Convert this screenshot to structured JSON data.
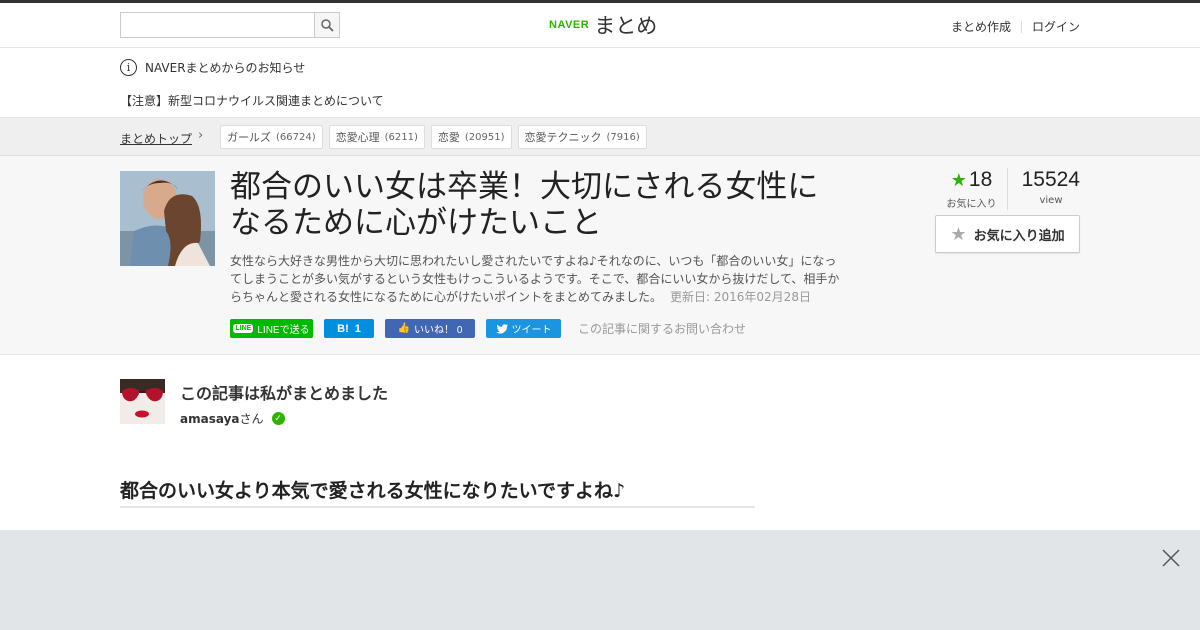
{
  "header": {
    "search_placeholder": "",
    "logo_brand": "NAVER",
    "logo_title": "まとめ",
    "create_link": "まとめ作成",
    "login_link": "ログイン"
  },
  "notice": {
    "heading": "NAVERまとめからのお知らせ",
    "item": "【注意】新型コロナウイルス関連まとめについて"
  },
  "breadcrumb": {
    "top": "まとめトップ",
    "tags": [
      {
        "label": "ガールズ",
        "count": "(66724)"
      },
      {
        "label": "恋愛心理",
        "count": "(6211)"
      },
      {
        "label": "恋愛",
        "count": "(20951)"
      },
      {
        "label": "恋愛テクニック",
        "count": "(7916)"
      }
    ]
  },
  "article": {
    "title": "都合のいい女は卒業！大切にされる女性になるために心がけたいこと",
    "description": "女性なら大好きな男性から大切に思われたいし愛されたいですよね♪それなのに、いつも「都合のいい女」になってしまうことが多い気がするという女性もけっこういるようです。そこで、都合にいい女から抜けだして、相手からちゃんと愛される女性になるために心がけたいポイントをまとめてみました。",
    "updated": "更新日: 2016年02月28日",
    "favorites": "18",
    "favorites_label": "お気に入り",
    "views": "15524",
    "views_label": "view",
    "fav_button": "お気に入り追加"
  },
  "share": {
    "line": "LINEで送る",
    "hatena": "1",
    "facebook": "いいね！ 0",
    "twitter": "ツイート",
    "contact": "この記事に関するお問い合わせ"
  },
  "author": {
    "heading": "この記事は私がまとめました",
    "name": "amasaya",
    "suffix": "さん"
  },
  "section": {
    "heading": "都合のいい女より本気で愛される女性になりたいですよね♪"
  },
  "colors": {
    "naver_green": "#2db400",
    "line_green": "#00b900",
    "hatena_blue": "#008fde",
    "facebook_blue": "#4267b2",
    "twitter_blue": "#1b95e0"
  }
}
